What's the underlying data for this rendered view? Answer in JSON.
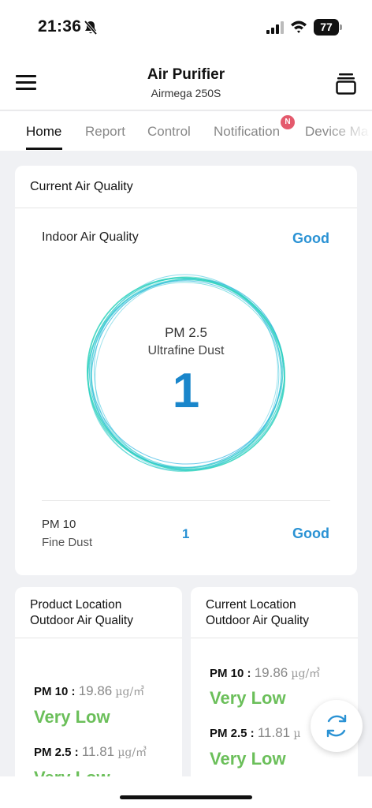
{
  "status_bar": {
    "time": "21:36",
    "battery": "77"
  },
  "header": {
    "title": "Air Purifier",
    "subtitle": "Airmega 250S"
  },
  "tabs": [
    {
      "label": "Home",
      "active": true
    },
    {
      "label": "Report"
    },
    {
      "label": "Control"
    },
    {
      "label": "Notification",
      "badge": "N"
    },
    {
      "label": "Device Ma"
    }
  ],
  "current_air_quality": {
    "title": "Current Air Quality",
    "indoor_label": "Indoor Air Quality",
    "indoor_status": "Good",
    "pm25": {
      "label": "PM 2.5",
      "sublabel": "Ultrafine Dust",
      "value": "1"
    },
    "pm10": {
      "label": "PM 10",
      "sublabel": "Fine Dust",
      "value": "1",
      "status": "Good"
    }
  },
  "product_location": {
    "title_line1": "Product Location",
    "title_line2": "Outdoor Air Quality",
    "pm10": {
      "label": "PM 10 :",
      "value": "19.86",
      "unit": "µg/㎥",
      "status": "Very Low"
    },
    "pm25": {
      "label": "PM 2.5 :",
      "value": "11.81",
      "unit": "µg/㎥",
      "status": "Very Low"
    }
  },
  "current_location": {
    "title_line1": "Current Location",
    "title_line2": "Outdoor Air Quality",
    "pm10": {
      "label": "PM 10 :",
      "value": "19.86",
      "unit": "µg/㎥",
      "status": "Very Low"
    },
    "pm25": {
      "label": "PM 2.5 :",
      "value": "11.81",
      "unit": "µ",
      "status": "Very Low"
    }
  },
  "colors": {
    "accent_blue": "#2a92d4",
    "good_green": "#6bbf5a",
    "ring_teal": "#3fd0c8",
    "badge_red": "#e45a6d"
  },
  "icons": [
    "bell-off-icon",
    "signal-icon",
    "wifi-icon",
    "battery-icon",
    "menu-icon",
    "device-stack-icon",
    "refresh-icon"
  ]
}
